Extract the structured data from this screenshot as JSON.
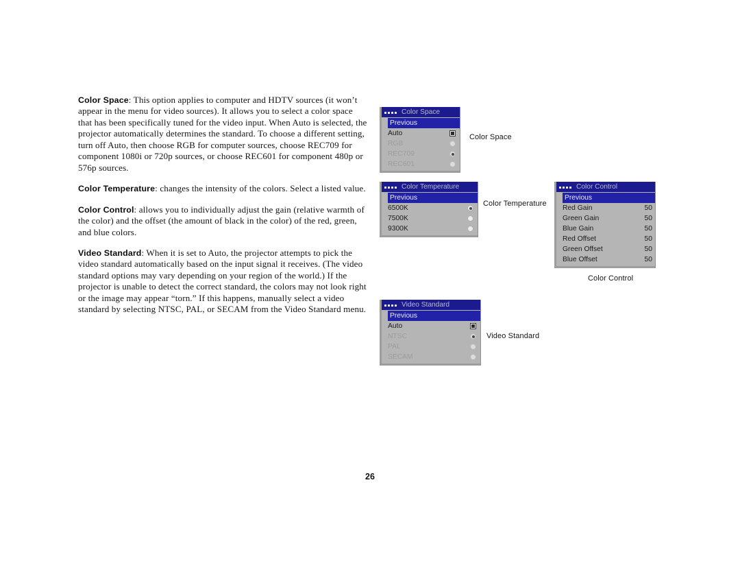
{
  "document": {
    "page_number": "26"
  },
  "body": {
    "paragraphs": [
      {
        "lead": "Color Space",
        "text": ": This option applies to computer and HDTV sources (it won’t appear in the menu for video sources). It allows you to select a color space that has been specifically tuned for the video input. When Auto is selected, the projector automatically determines the standard. To choose a different setting, turn off Auto, then choose RGB for computer sources, choose REC709 for component 1080i or 720p sources, or choose REC601 for component 480p or 576p sources."
      },
      {
        "lead": "Color Temperature",
        "text": ": changes the intensity of the colors. Select a listed value."
      },
      {
        "lead": "Color Control",
        "text": ": allows you to individually adjust the gain (relative warmth of the color) and the offset (the amount of black in the color) of the red, green, and blue colors."
      },
      {
        "lead": "Video Standard",
        "text": ": When it is set to Auto, the projector attempts to pick the video standard automatically based on the input signal it receives. (The video standard options may vary depending on your region of the world.) If the projector is unable to detect the correct standard, the colors may not look right or the image may appear “torn.” If this happens, manually select a video standard by selecting NTSC, PAL, or SECAM from the Video Standard menu."
      }
    ]
  },
  "menus": {
    "color_space": {
      "title": "Color Space",
      "caption": "Color Space",
      "rows": [
        {
          "label": "Previous",
          "control": "none",
          "state": "highlight"
        },
        {
          "label": "Auto",
          "control": "checkbox",
          "state": "checked"
        },
        {
          "label": "RGB",
          "control": "radio",
          "state": "dim-off"
        },
        {
          "label": "REC709",
          "control": "radio",
          "state": "dim-on"
        },
        {
          "label": "REC601",
          "control": "radio",
          "state": "dim-off"
        }
      ]
    },
    "color_temperature": {
      "title": "Color Temperature",
      "caption": "Color Temperature",
      "rows": [
        {
          "label": "Previous",
          "control": "none",
          "state": "highlight"
        },
        {
          "label": "6500K",
          "control": "radio",
          "state": "on"
        },
        {
          "label": "7500K",
          "control": "radio",
          "state": "off"
        },
        {
          "label": "9300K",
          "control": "radio",
          "state": "off"
        }
      ]
    },
    "color_control": {
      "title": "Color Control",
      "caption": "Color Control",
      "rows": [
        {
          "label": "Previous",
          "control": "none",
          "state": "highlight",
          "value": ""
        },
        {
          "label": "Red Gain",
          "control": "value",
          "state": "normal",
          "value": "50"
        },
        {
          "label": "Green Gain",
          "control": "value",
          "state": "normal",
          "value": "50"
        },
        {
          "label": "Blue Gain",
          "control": "value",
          "state": "normal",
          "value": "50"
        },
        {
          "label": "Red Offset",
          "control": "value",
          "state": "normal",
          "value": "50"
        },
        {
          "label": "Green Offset",
          "control": "value",
          "state": "normal",
          "value": "50"
        },
        {
          "label": "Blue Offset",
          "control": "value",
          "state": "normal",
          "value": "50"
        }
      ]
    },
    "video_standard": {
      "title": "Video Standard",
      "caption": "Video Standard",
      "rows": [
        {
          "label": "Previous",
          "control": "none",
          "state": "highlight"
        },
        {
          "label": "Auto",
          "control": "checkbox",
          "state": "checked"
        },
        {
          "label": "NTSC",
          "control": "radio",
          "state": "dim-on"
        },
        {
          "label": "PAL",
          "control": "radio",
          "state": "dim-off"
        },
        {
          "label": "SECAM",
          "control": "radio",
          "state": "dim-off"
        }
      ]
    }
  },
  "colors": {
    "menu_titlebar": "#1b1b8f",
    "menu_body": "#b5b5b5",
    "menu_highlight": "#2222a8",
    "menu_frame": "#9d9d9d"
  }
}
